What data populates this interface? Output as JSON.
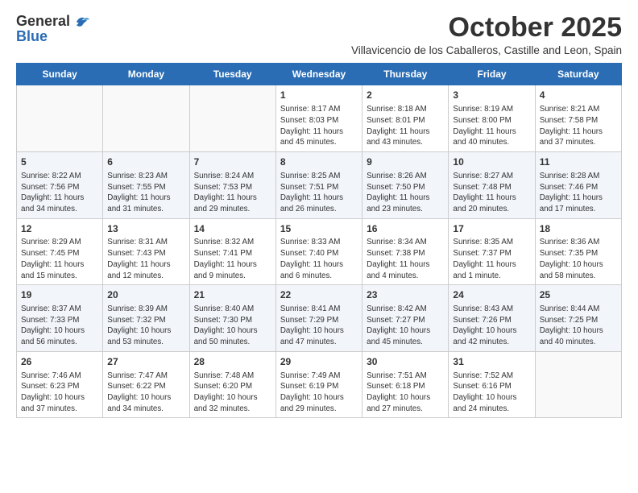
{
  "logo": {
    "general": "General",
    "blue": "Blue"
  },
  "header": {
    "month": "October 2025",
    "subtitle": "Villavicencio de los Caballeros, Castille and Leon, Spain"
  },
  "days_of_week": [
    "Sunday",
    "Monday",
    "Tuesday",
    "Wednesday",
    "Thursday",
    "Friday",
    "Saturday"
  ],
  "weeks": [
    {
      "shaded": false,
      "days": [
        {
          "number": "",
          "info": ""
        },
        {
          "number": "",
          "info": ""
        },
        {
          "number": "",
          "info": ""
        },
        {
          "number": "1",
          "info": "Sunrise: 8:17 AM\nSunset: 8:03 PM\nDaylight: 11 hours and 45 minutes."
        },
        {
          "number": "2",
          "info": "Sunrise: 8:18 AM\nSunset: 8:01 PM\nDaylight: 11 hours and 43 minutes."
        },
        {
          "number": "3",
          "info": "Sunrise: 8:19 AM\nSunset: 8:00 PM\nDaylight: 11 hours and 40 minutes."
        },
        {
          "number": "4",
          "info": "Sunrise: 8:21 AM\nSunset: 7:58 PM\nDaylight: 11 hours and 37 minutes."
        }
      ]
    },
    {
      "shaded": true,
      "days": [
        {
          "number": "5",
          "info": "Sunrise: 8:22 AM\nSunset: 7:56 PM\nDaylight: 11 hours and 34 minutes."
        },
        {
          "number": "6",
          "info": "Sunrise: 8:23 AM\nSunset: 7:55 PM\nDaylight: 11 hours and 31 minutes."
        },
        {
          "number": "7",
          "info": "Sunrise: 8:24 AM\nSunset: 7:53 PM\nDaylight: 11 hours and 29 minutes."
        },
        {
          "number": "8",
          "info": "Sunrise: 8:25 AM\nSunset: 7:51 PM\nDaylight: 11 hours and 26 minutes."
        },
        {
          "number": "9",
          "info": "Sunrise: 8:26 AM\nSunset: 7:50 PM\nDaylight: 11 hours and 23 minutes."
        },
        {
          "number": "10",
          "info": "Sunrise: 8:27 AM\nSunset: 7:48 PM\nDaylight: 11 hours and 20 minutes."
        },
        {
          "number": "11",
          "info": "Sunrise: 8:28 AM\nSunset: 7:46 PM\nDaylight: 11 hours and 17 minutes."
        }
      ]
    },
    {
      "shaded": false,
      "days": [
        {
          "number": "12",
          "info": "Sunrise: 8:29 AM\nSunset: 7:45 PM\nDaylight: 11 hours and 15 minutes."
        },
        {
          "number": "13",
          "info": "Sunrise: 8:31 AM\nSunset: 7:43 PM\nDaylight: 11 hours and 12 minutes."
        },
        {
          "number": "14",
          "info": "Sunrise: 8:32 AM\nSunset: 7:41 PM\nDaylight: 11 hours and 9 minutes."
        },
        {
          "number": "15",
          "info": "Sunrise: 8:33 AM\nSunset: 7:40 PM\nDaylight: 11 hours and 6 minutes."
        },
        {
          "number": "16",
          "info": "Sunrise: 8:34 AM\nSunset: 7:38 PM\nDaylight: 11 hours and 4 minutes."
        },
        {
          "number": "17",
          "info": "Sunrise: 8:35 AM\nSunset: 7:37 PM\nDaylight: 11 hours and 1 minute."
        },
        {
          "number": "18",
          "info": "Sunrise: 8:36 AM\nSunset: 7:35 PM\nDaylight: 10 hours and 58 minutes."
        }
      ]
    },
    {
      "shaded": true,
      "days": [
        {
          "number": "19",
          "info": "Sunrise: 8:37 AM\nSunset: 7:33 PM\nDaylight: 10 hours and 56 minutes."
        },
        {
          "number": "20",
          "info": "Sunrise: 8:39 AM\nSunset: 7:32 PM\nDaylight: 10 hours and 53 minutes."
        },
        {
          "number": "21",
          "info": "Sunrise: 8:40 AM\nSunset: 7:30 PM\nDaylight: 10 hours and 50 minutes."
        },
        {
          "number": "22",
          "info": "Sunrise: 8:41 AM\nSunset: 7:29 PM\nDaylight: 10 hours and 47 minutes."
        },
        {
          "number": "23",
          "info": "Sunrise: 8:42 AM\nSunset: 7:27 PM\nDaylight: 10 hours and 45 minutes."
        },
        {
          "number": "24",
          "info": "Sunrise: 8:43 AM\nSunset: 7:26 PM\nDaylight: 10 hours and 42 minutes."
        },
        {
          "number": "25",
          "info": "Sunrise: 8:44 AM\nSunset: 7:25 PM\nDaylight: 10 hours and 40 minutes."
        }
      ]
    },
    {
      "shaded": false,
      "days": [
        {
          "number": "26",
          "info": "Sunrise: 7:46 AM\nSunset: 6:23 PM\nDaylight: 10 hours and 37 minutes."
        },
        {
          "number": "27",
          "info": "Sunrise: 7:47 AM\nSunset: 6:22 PM\nDaylight: 10 hours and 34 minutes."
        },
        {
          "number": "28",
          "info": "Sunrise: 7:48 AM\nSunset: 6:20 PM\nDaylight: 10 hours and 32 minutes."
        },
        {
          "number": "29",
          "info": "Sunrise: 7:49 AM\nSunset: 6:19 PM\nDaylight: 10 hours and 29 minutes."
        },
        {
          "number": "30",
          "info": "Sunrise: 7:51 AM\nSunset: 6:18 PM\nDaylight: 10 hours and 27 minutes."
        },
        {
          "number": "31",
          "info": "Sunrise: 7:52 AM\nSunset: 6:16 PM\nDaylight: 10 hours and 24 minutes."
        },
        {
          "number": "",
          "info": ""
        }
      ]
    }
  ]
}
